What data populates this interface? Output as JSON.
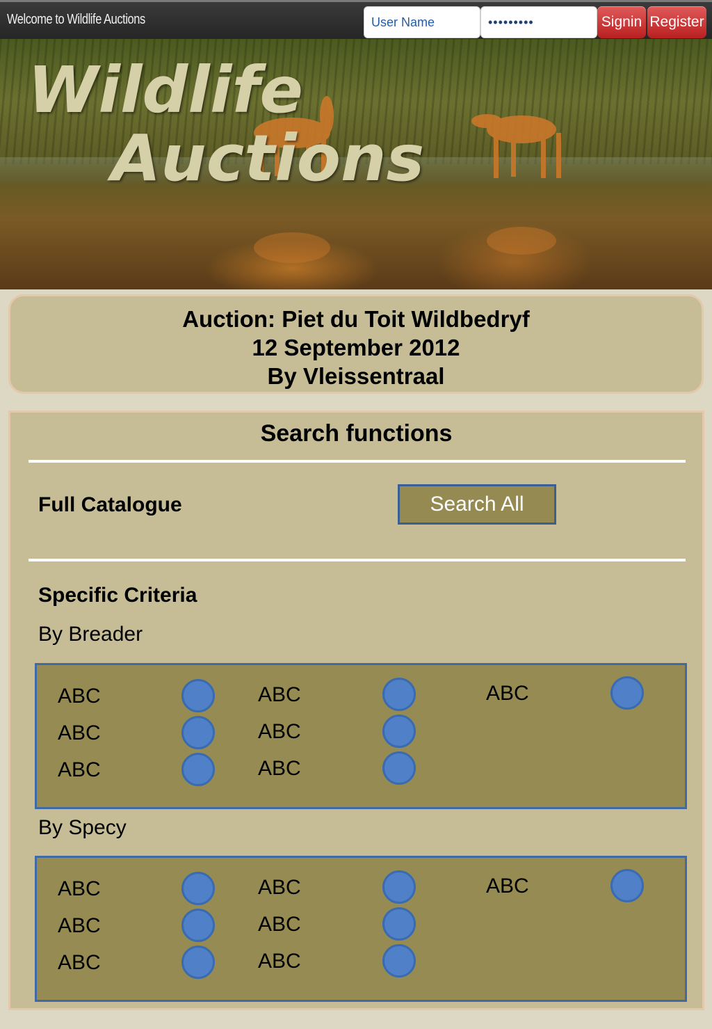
{
  "topbar": {
    "welcome": "Welcome to Wildlife Auctions",
    "username_placeholder": "User Name",
    "password_value": "•••••••••",
    "signin_label": "Signin",
    "register_label": "Register"
  },
  "banner": {
    "title_line1": "Wildlife",
    "title_line2": "Auctions"
  },
  "auction": {
    "line1": "Auction: Piet du Toit Wildbedryf",
    "line2": "12 September 2012",
    "line3": "By Vleissentraal"
  },
  "search": {
    "title": "Search functions",
    "full_catalogue_label": "Full Catalogue",
    "search_all_label": "Search All",
    "specific_criteria_label": "Specific Criteria",
    "by_breeder_label": "By Breader",
    "by_species_label": "By Specy",
    "breeder_options": [
      "ABC",
      "ABC",
      "ABC",
      "ABC",
      "ABC",
      "ABC",
      "ABC"
    ],
    "species_options": [
      "ABC",
      "ABC",
      "ABC",
      "ABC",
      "ABC",
      "ABC",
      "ABC"
    ]
  },
  "colors": {
    "topbar": "#2e2e2e",
    "button_red": "#c93030",
    "panel": "#c6bd97",
    "criteria_box": "#968b52",
    "radio": "#4f80c8"
  }
}
